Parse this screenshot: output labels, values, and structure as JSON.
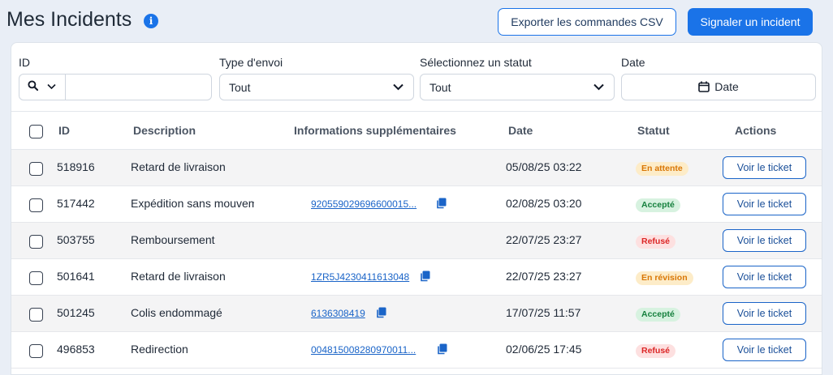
{
  "header": {
    "title": "Mes Incidents",
    "info_icon": "info-icon",
    "export_label": "Exporter les commandes CSV",
    "report_label": "Signaler un incident"
  },
  "filters": {
    "id_label": "ID",
    "id_value": "",
    "type_label": "Type d'envoi",
    "type_value": "Tout",
    "status_label": "Sélectionnez un statut",
    "status_value": "Tout",
    "date_label": "Date",
    "date_placeholder": "Date"
  },
  "table": {
    "columns": [
      "ID",
      "Description",
      "Informations supplémentaires",
      "Date",
      "Statut",
      "Actions"
    ],
    "action_label": "Voir le ticket",
    "rows": [
      {
        "id": "518916",
        "description": "Retard de livraison",
        "info": "",
        "date": "05/08/25 03:22",
        "status": "En attente",
        "status_kind": "pending"
      },
      {
        "id": "517442",
        "description": "Expédition sans mouvement",
        "info": "920559029696600015...",
        "date": "02/08/25 03:20",
        "status": "Accepté",
        "status_kind": "accepted"
      },
      {
        "id": "503755",
        "description": "Remboursement",
        "info": "",
        "date": "22/07/25 23:27",
        "status": "Refusé",
        "status_kind": "refused"
      },
      {
        "id": "501641",
        "description": "Retard de livraison",
        "info": "1ZR5J4230411613048",
        "date": "22/07/25 23:27",
        "status": "En révision",
        "status_kind": "review"
      },
      {
        "id": "501245",
        "description": "Colis endommagé",
        "info": "6136308419",
        "date": "17/07/25 11:57",
        "status": "Accepté",
        "status_kind": "accepted"
      },
      {
        "id": "496853",
        "description": "Redirection",
        "info": "004815008280970011...",
        "date": "02/06/25 17:45",
        "status": "Refusé",
        "status_kind": "refused"
      }
    ]
  },
  "colors": {
    "accent": "#1a73e8",
    "pending": "#d97706",
    "accepted": "#15803d",
    "refused": "#dc2626"
  }
}
